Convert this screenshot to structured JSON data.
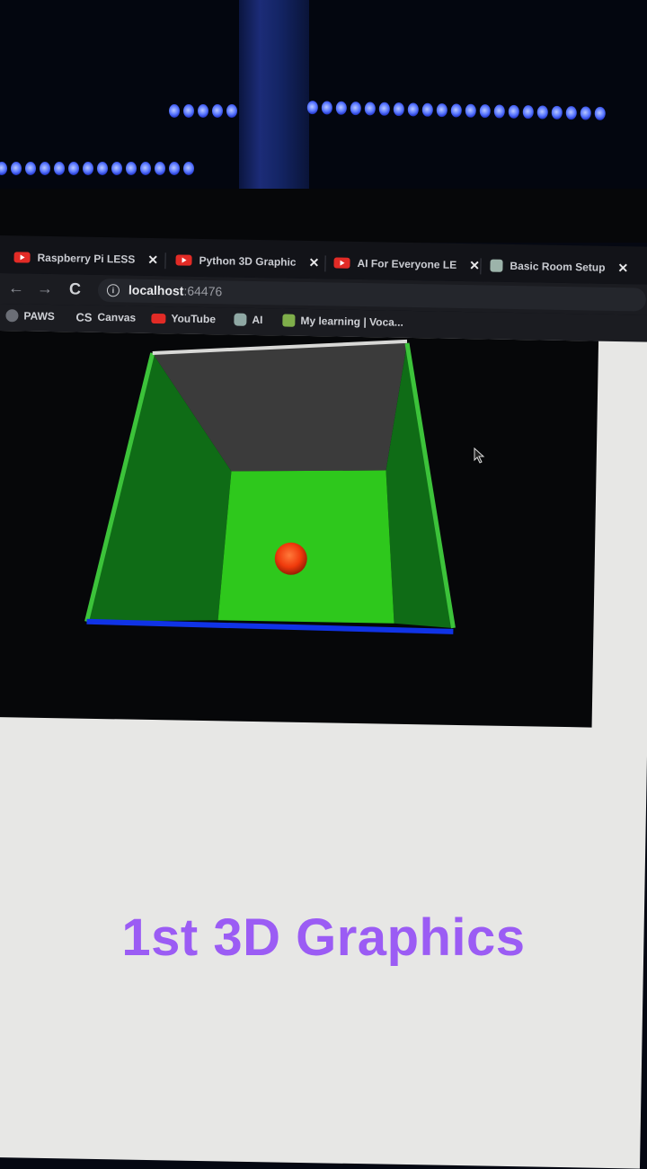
{
  "browser": {
    "tabs": [
      {
        "label": "Raspberry Pi LESS",
        "favicon": "youtube-icon"
      },
      {
        "label": "Python 3D Graphic",
        "favicon": "youtube-icon"
      },
      {
        "label": "AI For Everyone LE",
        "favicon": "youtube-icon"
      },
      {
        "label": "Basic Room Setup",
        "favicon": "page-icon"
      }
    ],
    "close_glyph": "✕",
    "nav": {
      "back": "←",
      "forward": "→",
      "reload": "C"
    },
    "address": {
      "host": "localhost",
      "port": ":64476",
      "info": "i"
    },
    "bookmarks": [
      {
        "label": "PAWS",
        "icon": "globe-icon"
      },
      {
        "label": "Canvas",
        "icon": "canvas-icon"
      },
      {
        "label": "YouTube",
        "icon": "youtube-icon"
      },
      {
        "label": "AI",
        "icon": "openai-icon"
      },
      {
        "label": "My learning | Voca...",
        "icon": "vocareum-icon"
      }
    ]
  },
  "scene": {
    "objects": [
      "room-floor",
      "room-walls",
      "room-ceiling",
      "red-ball"
    ],
    "colors": {
      "floor": "#2ec81c",
      "wall": "#0f6c16",
      "wall_edge": "#3cc33a",
      "ceiling": "#3b3b3b",
      "floor_edge": "#1033e6",
      "ball": "#f03a0c"
    }
  },
  "overlay": {
    "title": "1st 3D Graphics",
    "color": "#9b5cf4"
  }
}
